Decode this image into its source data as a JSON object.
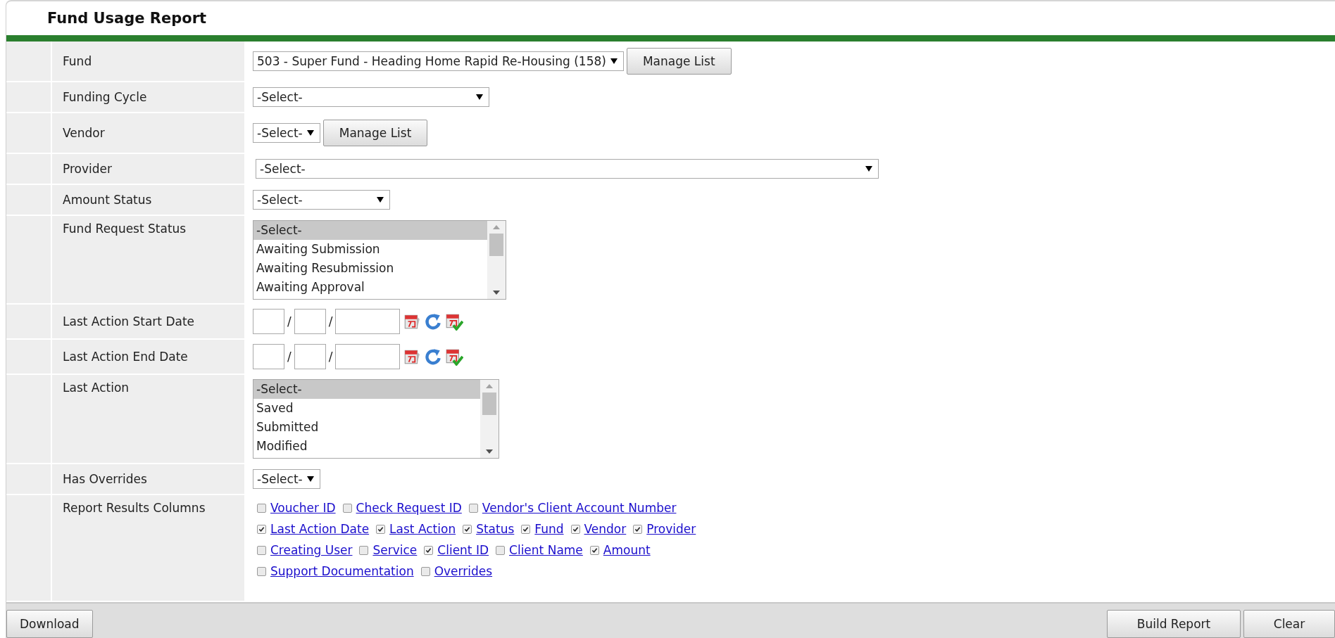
{
  "title": "Fund Usage Report",
  "fields": [
    {
      "label": "Fund",
      "kind": "select",
      "value": "503 - Super Fund - Heading Home Rapid Re-Housing (158)",
      "button": "Manage List"
    },
    {
      "label": "Funding Cycle",
      "kind": "select",
      "value": "-Select-"
    },
    {
      "label": "Vendor",
      "kind": "select",
      "value": "-Select-",
      "button": "Manage List"
    },
    {
      "label": "Provider",
      "kind": "select",
      "value": "-Select-"
    },
    {
      "label": "Amount Status",
      "kind": "select",
      "value": "-Select-"
    },
    {
      "label": "Fund Request Status",
      "kind": "listbox",
      "options": [
        {
          "text": "-Select-",
          "selected": true
        },
        {
          "text": "Awaiting Submission",
          "selected": false
        },
        {
          "text": "Awaiting Resubmission",
          "selected": false
        },
        {
          "text": "Awaiting Approval",
          "selected": false
        }
      ]
    },
    {
      "label": "Last Action Start Date",
      "kind": "date",
      "separators": [
        "/",
        "/"
      ]
    },
    {
      "label": "Last Action End Date",
      "kind": "date",
      "separators": [
        "/",
        "/"
      ]
    },
    {
      "label": "Last Action",
      "kind": "listbox",
      "options": [
        {
          "text": "-Select-",
          "selected": true
        },
        {
          "text": "Saved",
          "selected": false
        },
        {
          "text": "Submitted",
          "selected": false
        },
        {
          "text": "Modified",
          "selected": false
        }
      ]
    },
    {
      "label": "Has Overrides",
      "kind": "select",
      "value": "-Select-"
    },
    {
      "label": "Report Results Columns",
      "kind": "checks",
      "lines": [
        [
          {
            "text": "Voucher ID",
            "checked": false
          },
          {
            "text": "Check Request ID",
            "checked": false
          },
          {
            "text": "Vendor's Client Account Number",
            "checked": false
          }
        ],
        [
          {
            "text": "Last Action Date",
            "checked": true
          },
          {
            "text": "Last Action",
            "checked": true
          },
          {
            "text": "Status",
            "checked": true
          },
          {
            "text": "Fund",
            "checked": true
          },
          {
            "text": "Vendor",
            "checked": true
          },
          {
            "text": "Provider",
            "checked": true
          }
        ],
        [
          {
            "text": "Creating User",
            "checked": false
          },
          {
            "text": "Service",
            "checked": false
          },
          {
            "text": "Client ID",
            "checked": true
          },
          {
            "text": "Client Name",
            "checked": false
          },
          {
            "text": "Amount",
            "checked": true
          }
        ],
        [
          {
            "text": "Support Documentation",
            "checked": false
          },
          {
            "text": "Overrides",
            "checked": false
          }
        ]
      ]
    }
  ],
  "footer": {
    "left": [
      "Download"
    ],
    "right": [
      "Build Report",
      "Clear"
    ]
  }
}
